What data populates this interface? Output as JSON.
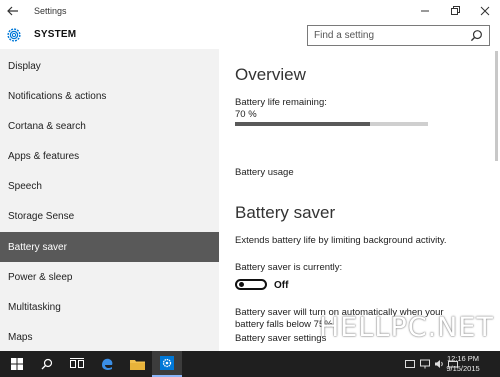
{
  "window": {
    "title": "Settings",
    "back_icon": "back-arrow-icon",
    "controls": [
      "minimize-icon",
      "maximize-icon",
      "close-icon"
    ]
  },
  "header": {
    "title": "SYSTEM",
    "icon": "gear-icon",
    "search_placeholder": "Find a setting"
  },
  "sidebar": {
    "items": [
      {
        "label": "Display"
      },
      {
        "label": "Notifications & actions"
      },
      {
        "label": "Cortana & search"
      },
      {
        "label": "Apps & features"
      },
      {
        "label": "Speech"
      },
      {
        "label": "Storage Sense"
      },
      {
        "label": "Battery saver",
        "selected": true
      },
      {
        "label": "Power & sleep"
      },
      {
        "label": "Multitasking"
      },
      {
        "label": "Maps"
      }
    ]
  },
  "main": {
    "overview_heading": "Overview",
    "battery_life_label": "Battery life remaining:",
    "battery_percent": "70 %",
    "battery_level": 0.7,
    "battery_usage_link": "Battery usage",
    "saver_heading": "Battery saver",
    "saver_description": "Extends battery life by limiting background activity.",
    "saver_status_label": "Battery saver is currently:",
    "saver_state": "Off",
    "auto_line1": "Battery saver will turn on automatically when your",
    "auto_line2": "battery falls below 75%.",
    "settings_link": "Battery saver settings",
    "watermark": "HELLPC.NET"
  },
  "taskbar": {
    "icons": [
      "windows-start-icon",
      "search-icon",
      "task-view-icon",
      "edge-browser-icon",
      "file-explorer-icon",
      "settings-app-icon"
    ],
    "tray_icons": [
      "notifications-icon",
      "network-icon",
      "volume-icon",
      "keyboard-icon"
    ],
    "time": "12:16 PM",
    "date": "9/15/2015"
  },
  "colors": {
    "selected_bg": "#595959",
    "sidebar_bg": "#f2f2f2",
    "taskbar_bg": "#1f1f1f",
    "accent": "#0078d7"
  }
}
